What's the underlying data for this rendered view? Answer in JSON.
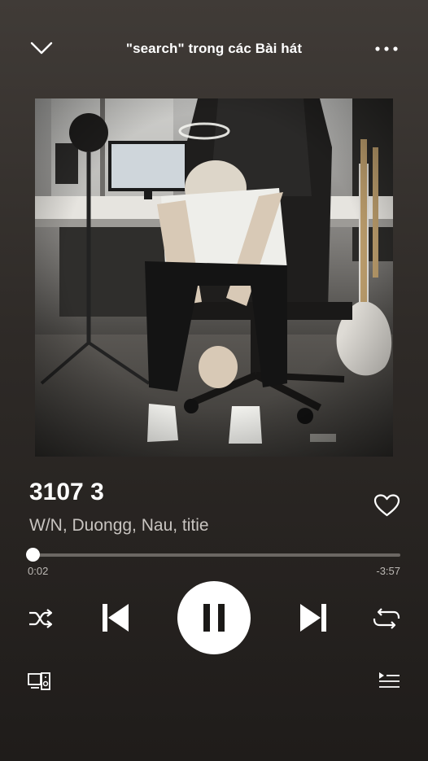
{
  "header": {
    "title": "\"search\" trong các Bài hát",
    "collapse_icon": "chevron-down-icon",
    "more_icon": "more-horizontal-icon"
  },
  "track": {
    "title": "3107 3",
    "artists": "W/N, Duongg, Nau, titie",
    "liked": false
  },
  "progress": {
    "elapsed": "0:02",
    "remaining": "-3:57",
    "fraction": 0.008
  },
  "controls": {
    "shuffle_icon": "shuffle-icon",
    "previous_icon": "skip-previous-icon",
    "play_pause_icon": "pause-icon",
    "next_icon": "skip-next-icon",
    "repeat_icon": "repeat-icon"
  },
  "bottom": {
    "devices_icon": "devices-icon",
    "queue_icon": "queue-icon"
  },
  "colors": {
    "background_top": "#403b37",
    "background_bottom": "#1f1c1a",
    "text_primary": "#ffffff",
    "text_secondary": "#c8c4c0",
    "track_bg": "#6b6763"
  }
}
